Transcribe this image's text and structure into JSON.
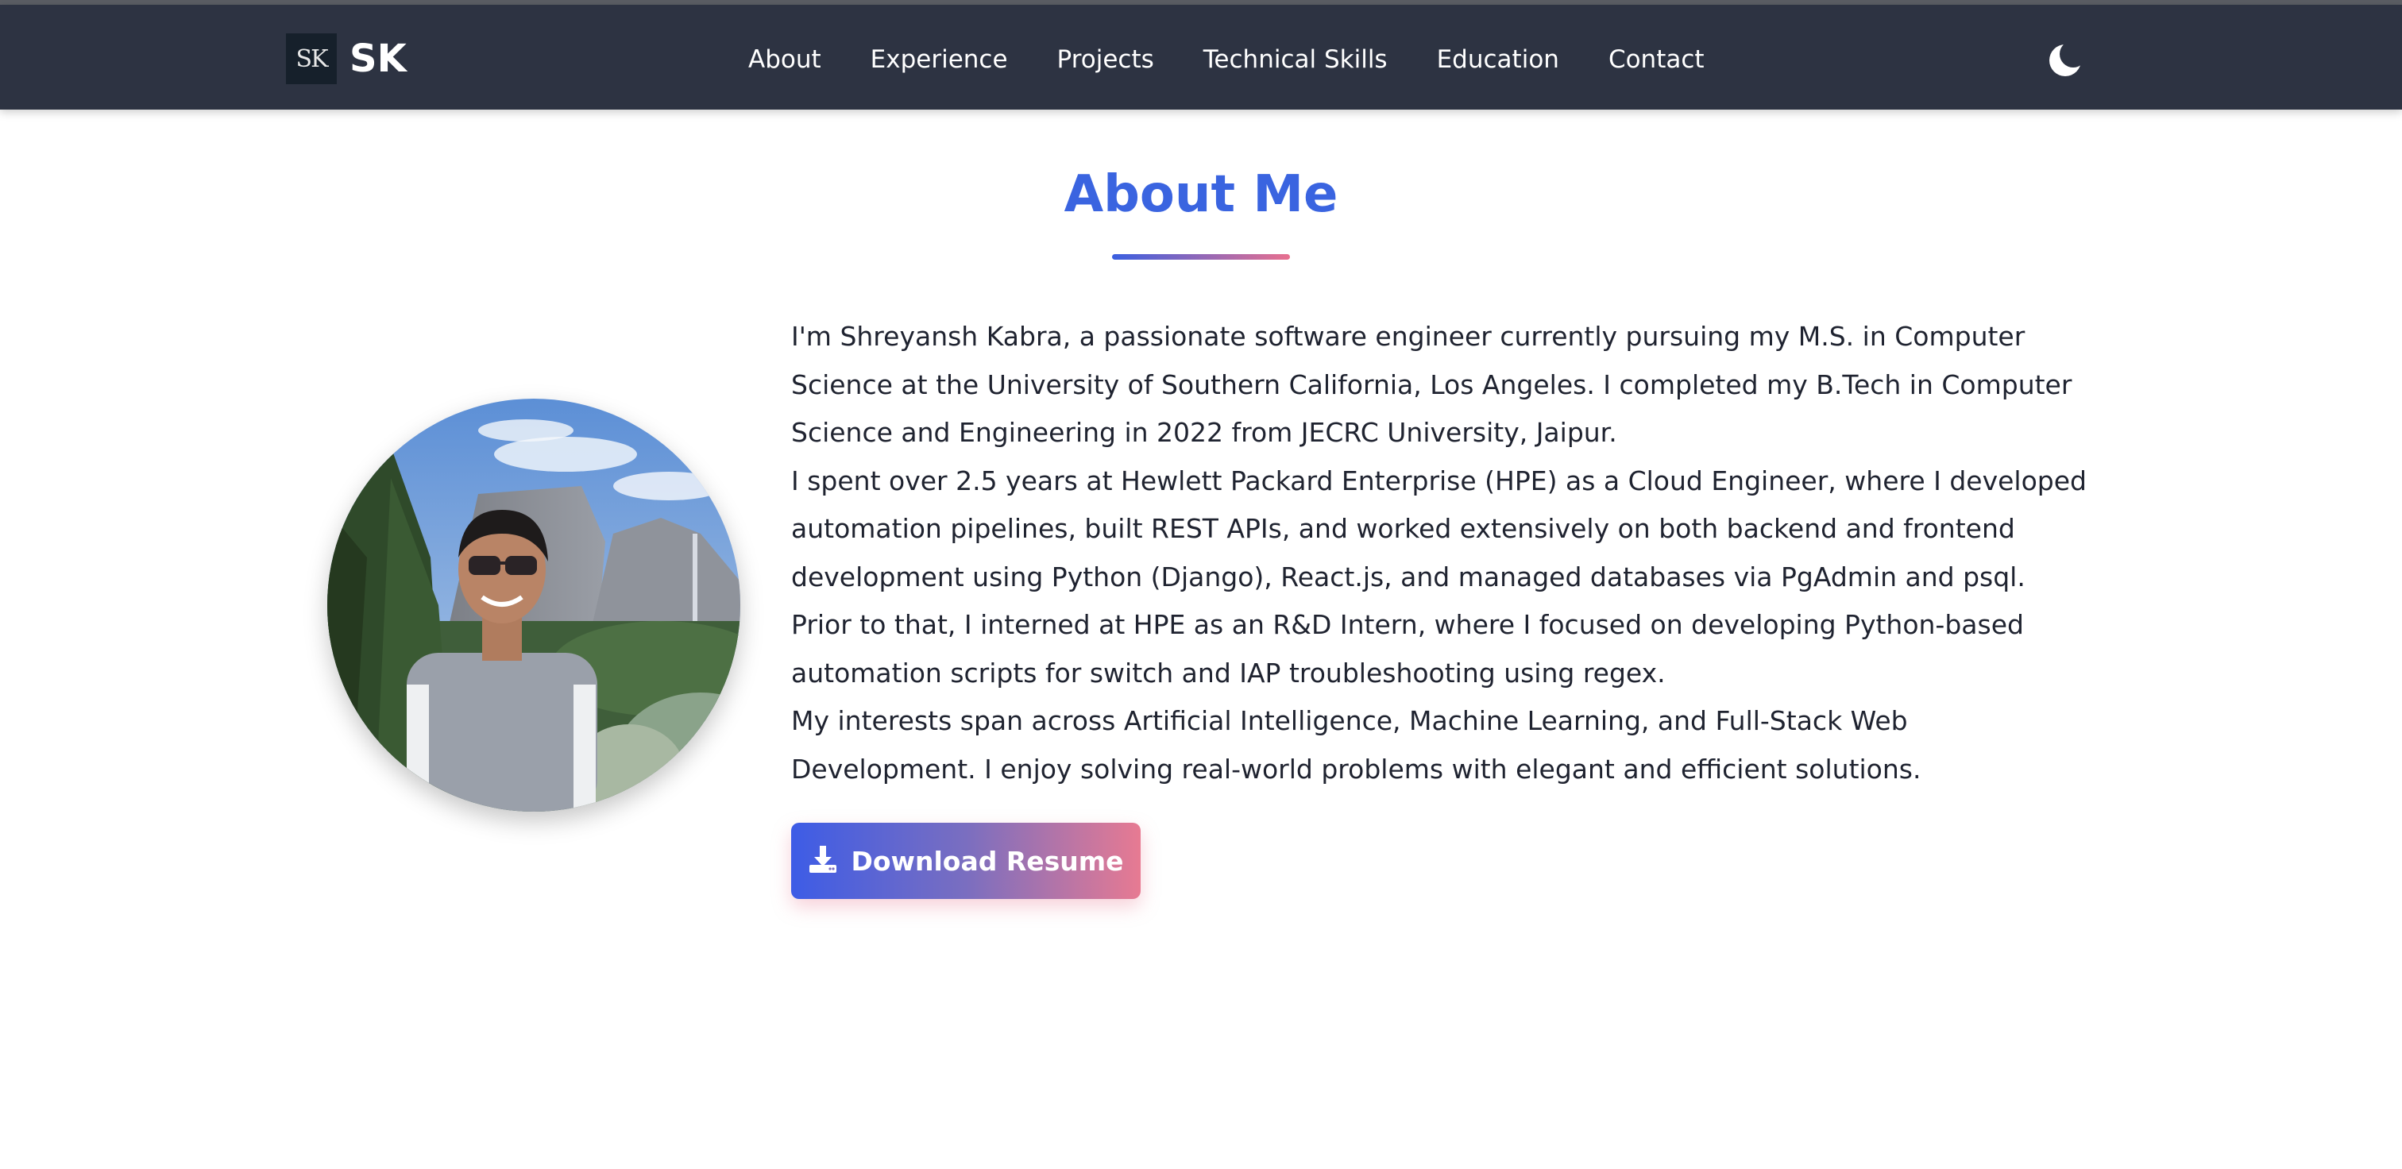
{
  "brand": {
    "logo_text": "SK",
    "name": "SK"
  },
  "nav": {
    "items": [
      {
        "label": "About"
      },
      {
        "label": "Experience"
      },
      {
        "label": "Projects"
      },
      {
        "label": "Technical Skills"
      },
      {
        "label": "Education"
      },
      {
        "label": "Contact"
      }
    ],
    "theme_icon": "moon-icon"
  },
  "about": {
    "title": "About Me",
    "paragraphs": [
      "I'm Shreyansh Kabra, a passionate software engineer currently pursuing my M.S. in Computer Science at the University of Southern California, Los Angeles. I completed my B.Tech in Computer Science and Engineering in 2022 from JECRC University, Jaipur.",
      "I spent over 2.5 years at Hewlett Packard Enterprise (HPE) as a Cloud Engineer, where I developed automation pipelines, built REST APIs, and worked extensively on both backend and frontend development using Python (Django), React.js, and managed databases via PgAdmin and psql.",
      "Prior to that, I interned at HPE as an R&D Intern, where I focused on developing Python-based automation scripts for switch and IAP troubleshooting using regex.",
      "My interests span across Artificial Intelligence, Machine Learning, and Full-Stack Web Development. I enjoy solving real-world problems with elegant and efficient solutions."
    ],
    "download_label": "Download Resume",
    "download_icon": "download-icon"
  },
  "colors": {
    "navbar": "#2d3342",
    "title": "#3a64e0",
    "gradient_start": "#3d5ce6",
    "gradient_end": "#e77a92"
  }
}
